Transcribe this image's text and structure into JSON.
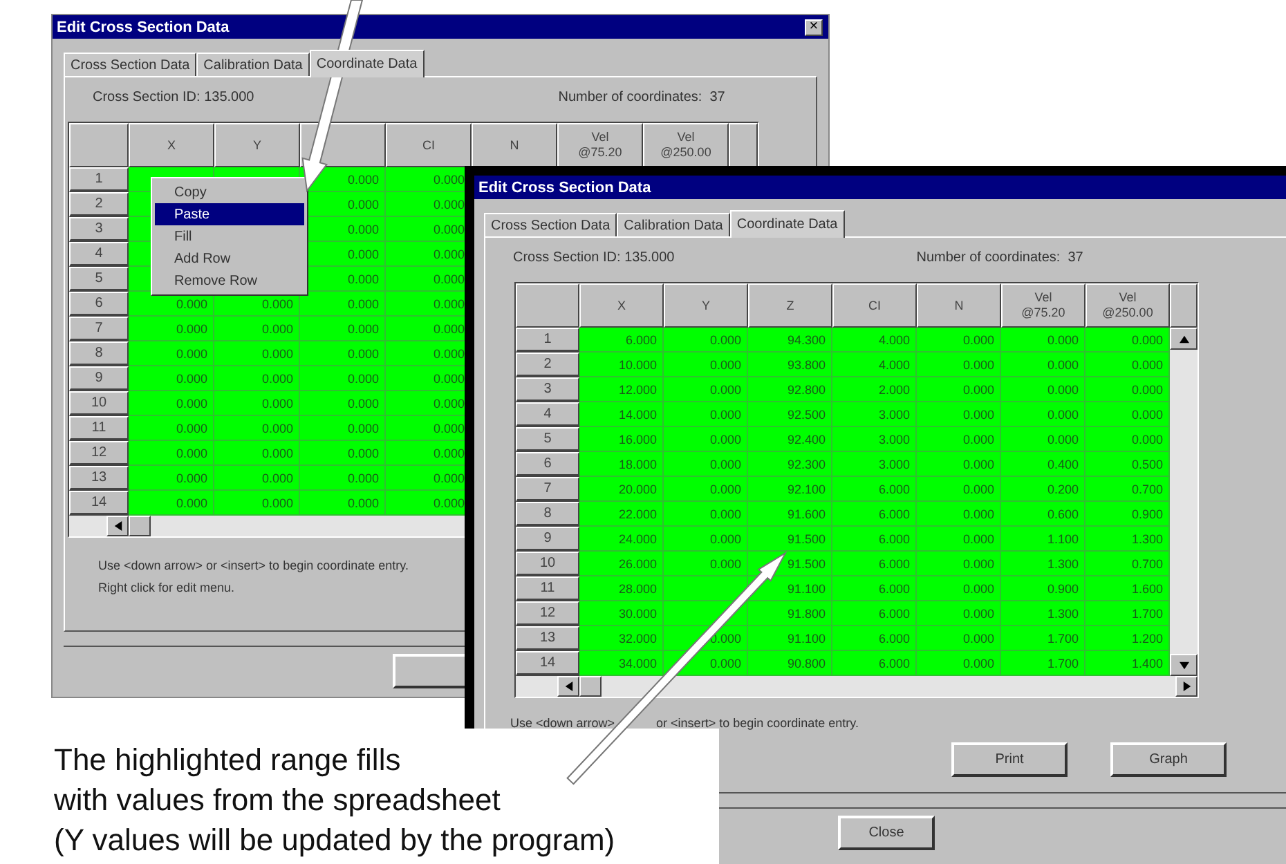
{
  "back_window": {
    "title": "Edit Cross Section Data",
    "close": "×",
    "tabs": [
      {
        "label": "Cross Section Data",
        "selected": false
      },
      {
        "label": "Calibration Data",
        "selected": false
      },
      {
        "label": "Coordinate Data",
        "selected": true
      }
    ],
    "cross_section_id": "Cross Section ID: 135.000",
    "coordinate_count": "Number of coordinates:  37",
    "columns": [
      {
        "label": "X"
      },
      {
        "label": "Y"
      },
      {},
      {
        "label": "CI"
      },
      {
        "label": "N"
      },
      {
        "label": "Vel\n@75.20"
      },
      {
        "label": "Vel\n@250.00"
      }
    ],
    "rows": [
      {
        "n": "1",
        "cells": [
          "0.000",
          "0.000"
        ]
      },
      {
        "n": "2",
        "cells": [
          "0.000",
          "0.000"
        ]
      },
      {
        "n": "3",
        "cells": [
          "0.000",
          "0.000"
        ]
      },
      {
        "n": "4",
        "cells": [
          "0.000",
          "0.000"
        ]
      },
      {
        "n": "5",
        "cells": [
          "0.000",
          "0.000"
        ]
      },
      {
        "n": "6",
        "cells": [
          "0.000",
          "0.000",
          "0.000",
          "0.000"
        ]
      },
      {
        "n": "7",
        "cells": [
          "0.000",
          "0.000",
          "0.000",
          "0.000"
        ]
      },
      {
        "n": "8",
        "cells": [
          "0.000",
          "0.000",
          "0.000",
          "0.000"
        ]
      },
      {
        "n": "9",
        "cells": [
          "0.000",
          "0.000",
          "0.000",
          "0.000"
        ]
      },
      {
        "n": "10",
        "cells": [
          "0.000",
          "0.000",
          "0.000",
          "0.000"
        ]
      },
      {
        "n": "11",
        "cells": [
          "0.000",
          "0.000",
          "0.000",
          "0.000"
        ]
      },
      {
        "n": "12",
        "cells": [
          "0.000",
          "0.000",
          "0.000",
          "0.000"
        ]
      },
      {
        "n": "13",
        "cells": [
          "0.000",
          "0.000",
          "0.000",
          "0.000"
        ]
      },
      {
        "n": "14",
        "cells": [
          "0.000",
          "0.000",
          "0.000",
          "0.000"
        ]
      }
    ],
    "instructions": [
      "Use <down arrow> or <insert> to begin coordinate entry.",
      "Right click for edit menu."
    ],
    "context_menu": [
      {
        "label": "Copy",
        "selected": false
      },
      {
        "label": "Paste",
        "selected": true
      },
      {
        "label": "Fill",
        "selected": false
      },
      {
        "label": "Add Row",
        "selected": false
      },
      {
        "label": "Remove Row",
        "selected": false
      }
    ]
  },
  "front_window": {
    "title": "Edit Cross Section Data",
    "tabs": [
      {
        "label": "Cross Section Data",
        "selected": false
      },
      {
        "label": "Calibration Data",
        "selected": false
      },
      {
        "label": "Coordinate Data",
        "selected": true
      }
    ],
    "cross_section_id": "Cross Section ID: 135.000",
    "coordinate_count": "Number of coordinates:  37",
    "columns": [
      {
        "label": "X"
      },
      {
        "label": "Y"
      },
      {
        "label": "Z"
      },
      {
        "label": "CI"
      },
      {
        "label": "N"
      },
      {
        "label": "Vel\n@75.20"
      },
      {
        "label": "Vel\n@250.00"
      }
    ],
    "rows": [
      {
        "n": "1",
        "cells": [
          "6.000",
          "0.000",
          "94.300",
          "4.000",
          "0.000",
          "0.000",
          "0.000"
        ]
      },
      {
        "n": "2",
        "cells": [
          "10.000",
          "0.000",
          "93.800",
          "4.000",
          "0.000",
          "0.000",
          "0.000"
        ]
      },
      {
        "n": "3",
        "cells": [
          "12.000",
          "0.000",
          "92.800",
          "2.000",
          "0.000",
          "0.000",
          "0.000"
        ]
      },
      {
        "n": "4",
        "cells": [
          "14.000",
          "0.000",
          "92.500",
          "3.000",
          "0.000",
          "0.000",
          "0.000"
        ]
      },
      {
        "n": "5",
        "cells": [
          "16.000",
          "0.000",
          "92.400",
          "3.000",
          "0.000",
          "0.000",
          "0.000"
        ]
      },
      {
        "n": "6",
        "cells": [
          "18.000",
          "0.000",
          "92.300",
          "3.000",
          "0.000",
          "0.400",
          "0.500"
        ]
      },
      {
        "n": "7",
        "cells": [
          "20.000",
          "0.000",
          "92.100",
          "6.000",
          "0.000",
          "0.200",
          "0.700"
        ]
      },
      {
        "n": "8",
        "cells": [
          "22.000",
          "0.000",
          "91.600",
          "6.000",
          "0.000",
          "0.600",
          "0.900"
        ]
      },
      {
        "n": "9",
        "cells": [
          "24.000",
          "0.000",
          "91.500",
          "6.000",
          "0.000",
          "1.100",
          "1.300"
        ]
      },
      {
        "n": "10",
        "cells": [
          "26.000",
          "0.000",
          "91.500",
          "6.000",
          "0.000",
          "1.300",
          "0.700"
        ]
      },
      {
        "n": "11",
        "cells": [
          "28.000",
          null,
          "91.100",
          "6.000",
          "0.000",
          "0.900",
          "1.600"
        ]
      },
      {
        "n": "12",
        "cells": [
          "30.000",
          null,
          "91.800",
          "6.000",
          "0.000",
          "1.300",
          "1.700"
        ]
      },
      {
        "n": "13",
        "cells": [
          "32.000",
          "0.000",
          "91.100",
          "6.000",
          "0.000",
          "1.700",
          "1.200"
        ]
      },
      {
        "n": "14",
        "cells": [
          "34.000",
          "0.000",
          "90.800",
          "6.000",
          "0.000",
          "1.700",
          "1.400"
        ]
      }
    ],
    "instructions": [
      "Use <down arrow>",
      "or <insert> to begin coordinate entry."
    ],
    "buttons": [
      "Print",
      "Graph"
    ],
    "close_button": "Close"
  },
  "caption": [
    "The highlighted range fills",
    "with values from the spreadsheet",
    "(Y values will be updated by the program)"
  ]
}
